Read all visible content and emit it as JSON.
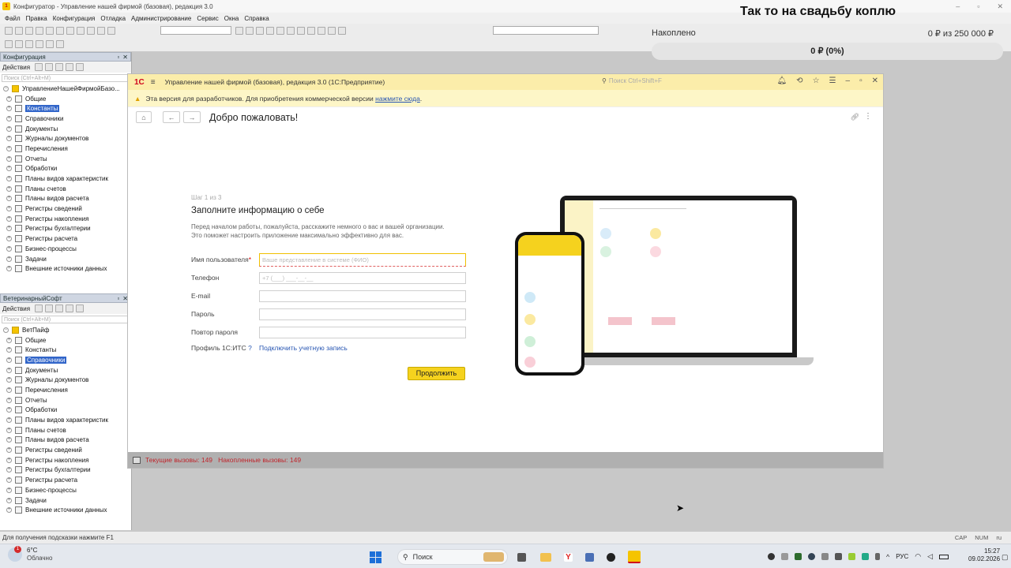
{
  "titlebar": {
    "app_icon": "1c-configurator-icon",
    "title": "Конфигуратор - Управление нашей фирмой (базовая), редакция 3.0"
  },
  "menubar": [
    "Файл",
    "Правка",
    "Конфигурация",
    "Отладка",
    "Администрирование",
    "Сервис",
    "Окна",
    "Справка"
  ],
  "overlay": {
    "title": "Так то на свадьбу коплю",
    "label": "Накоплено",
    "amount": "0 ₽ из 250 000 ₽",
    "percent": "0 ₽ (0%)",
    "progress": 0
  },
  "panel1": {
    "title": "Конфигурация",
    "actions": "Действия",
    "search": "Поиск (Ctrl+Alt+M)",
    "root": "УправлениеНашейФирмойБазо...",
    "items": [
      {
        "label": "Общие"
      },
      {
        "label": "Константы",
        "selected": true
      },
      {
        "label": "Справочники"
      },
      {
        "label": "Документы"
      },
      {
        "label": "Журналы документов"
      },
      {
        "label": "Перечисления"
      },
      {
        "label": "Отчеты"
      },
      {
        "label": "Обработки"
      },
      {
        "label": "Планы видов характеристик"
      },
      {
        "label": "Планы счетов"
      },
      {
        "label": "Планы видов расчета"
      },
      {
        "label": "Регистры сведений"
      },
      {
        "label": "Регистры накопления"
      },
      {
        "label": "Регистры бухгалтерии"
      },
      {
        "label": "Регистры расчета"
      },
      {
        "label": "Бизнес-процессы"
      },
      {
        "label": "Задачи"
      },
      {
        "label": "Внешние источники данных"
      }
    ]
  },
  "panel2": {
    "title": "ВетеринарныйСофт",
    "actions": "Действия",
    "search": "Поиск (Ctrl+Alt+M)",
    "root": "ВетПайф",
    "items": [
      {
        "label": "Общие"
      },
      {
        "label": "Константы"
      },
      {
        "label": "Справочники",
        "selected": true
      },
      {
        "label": "Документы"
      },
      {
        "label": "Журналы документов"
      },
      {
        "label": "Перечисления"
      },
      {
        "label": "Отчеты"
      },
      {
        "label": "Обработки"
      },
      {
        "label": "Планы видов характеристик"
      },
      {
        "label": "Планы счетов"
      },
      {
        "label": "Планы видов расчета"
      },
      {
        "label": "Регистры сведений"
      },
      {
        "label": "Регистры накопления"
      },
      {
        "label": "Регистры бухгалтерии"
      },
      {
        "label": "Регистры расчета"
      },
      {
        "label": "Бизнес-процессы"
      },
      {
        "label": "Задачи"
      },
      {
        "label": "Внешние источники данных"
      }
    ]
  },
  "enterprise": {
    "logo": "1С",
    "title": "Управление нашей фирмой (базовая), редакция 3.0 (1С:Предприятие)",
    "search_placeholder": "Поиск Ctrl+Shift+F",
    "banner_text": "Эта версия для разработчиков. Для приобретения коммерческой версии",
    "banner_link": "нажмите сюда",
    "banner_end": ".",
    "page_title": "Добро пожаловать!",
    "form": {
      "step": "Шаг 1 из 3",
      "heading": "Заполните информацию о себе",
      "desc1": "Перед началом работы, пожалуйста, расскажите немного о вас и вашей организации.",
      "desc2": "Это поможет настроить приложение максимально эффективно для вас.",
      "username_label": "Имя пользователя",
      "username_placeholder": "Ваше представление в системе (ФИО)",
      "phone_label": "Телефон",
      "phone_placeholder": "+7 (___) ___-__-__",
      "email_label": "E-mail",
      "password_label": "Пароль",
      "password_repeat_label": "Повтор пароля",
      "its_label": "Профиль 1С:ИТС",
      "its_help": "?",
      "its_link": "Подключить учетную запись",
      "continue_button": "Продолжить"
    },
    "status_calls": "Текущие вызовы: 149   Накопленные вызовы: 149"
  },
  "statusbar": {
    "hint": "Для получения подсказки нажмите F1",
    "cap": "CAP",
    "num": "NUM",
    "lang": "ru"
  },
  "taskbar": {
    "weather_temp": "6°C",
    "weather_desc": "Облачно",
    "weather_badge": "1",
    "search": "Поиск",
    "lang": "РУС",
    "time": "15:27",
    "date": "09.02.2026"
  }
}
